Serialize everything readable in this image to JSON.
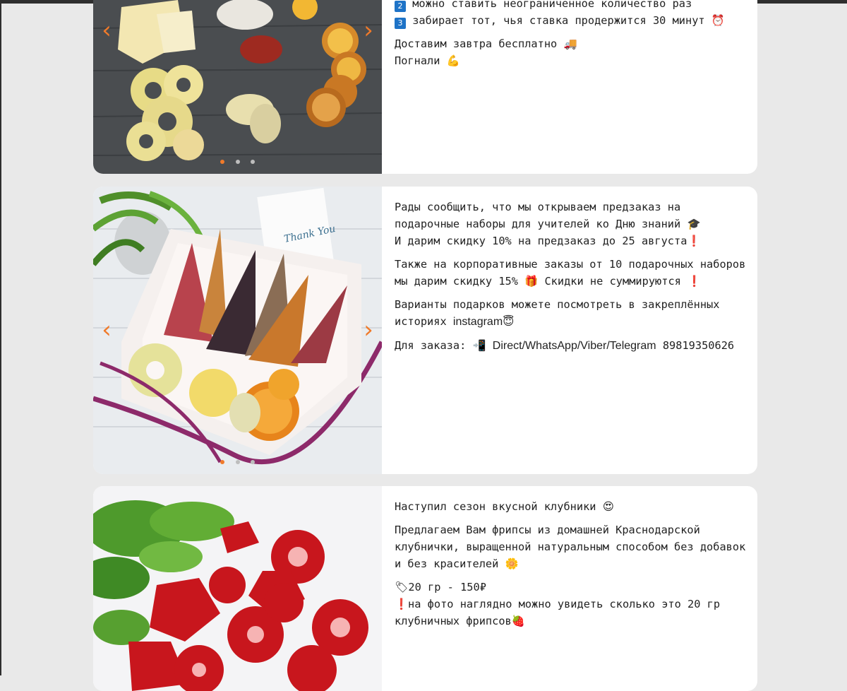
{
  "post1": {
    "line_partial": "можно ставить неограниченное количество раз",
    "line_partial_badge": "2",
    "line3_badge": "3",
    "line3": "забирает тот, чья ставка продержится 30 минут",
    "line3_emoji": "⏰",
    "line4": "Доставим завтра бесплатно",
    "line4_emoji": "🚚",
    "line5": "Погнали",
    "line5_emoji": "💪",
    "slider": {
      "prev": "‹",
      "next": "›",
      "dots": 3,
      "active": 0
    }
  },
  "post2": {
    "p1_l1": "Рады сообщить, что мы открываем предзаказ на",
    "p1_l2": "подарочные наборы для учителей ко Дню знаний",
    "p1_l2_emoji": "🎓",
    "p1_l3": "И дарим скидку 10% на предзаказ до 25 августа",
    "p1_l3_emoji": "❗",
    "p2_l1": "Также на корпоративные заказы от 10 подарочных наборов",
    "p2_l2": "мы дарим скидку 15%",
    "p2_l2_emoji": "🎁",
    "p2_l2_tail": "Скидки не суммируются",
    "p2_l2_tail_emoji": "❗",
    "p3_l1": "Варианты подарков можете посмотреть в закреплённых",
    "p3_l2": "историях",
    "p3_l2_brand": "instagram",
    "p3_l2_emoji": "😇",
    "p4_prefix": "Для заказа:",
    "p4_emoji": "📲",
    "p4_brand": "Direct/WhatsApp/Viber/Telegram",
    "p4_phone": "89819350626",
    "photo_card_text": "Thank You",
    "slider": {
      "prev": "‹",
      "next": "›",
      "dots": 3,
      "active": 0
    }
  },
  "post3": {
    "p1": "Наступил сезон вкусной клубники",
    "p1_emoji": "😍",
    "p2_l1": "Предлагаем Вам фрипсы из домашней Краснодарской",
    "p2_l2": "клубнички, выращенной натуральным способом без добавок",
    "p2_l3": "и без красителей",
    "p2_l3_emoji": "🌼",
    "p3_emoji": "🏷",
    "p3": "20 гр - 150₽",
    "p4_emoji": "❗",
    "p4_l1": "на фото наглядно можно увидеть сколько это 20 гр",
    "p4_l2": "клубничных фрипсов",
    "p4_l2_emoji": "🍓"
  },
  "colors": {
    "accent": "#f07a2a",
    "background": "#e9e9e9",
    "card": "#ffffff",
    "text": "#222222",
    "badge": "#1e73c7"
  }
}
